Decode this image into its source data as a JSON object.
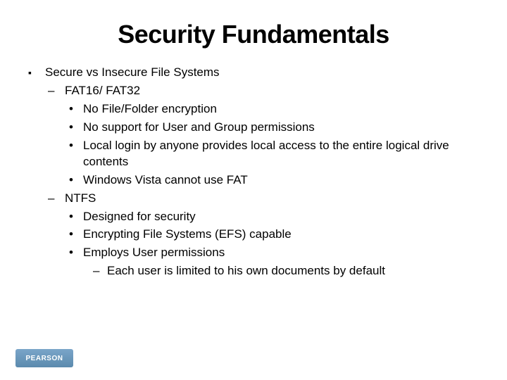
{
  "title": "Security Fundamentals",
  "topic": "Secure vs Insecure File Systems",
  "fat_label": "FAT16/ FAT32",
  "fat_points": [
    "No File/Folder encryption",
    "No support for User and Group permissions",
    "Local login by anyone provides local access to the entire logical drive contents",
    "Windows Vista cannot use FAT"
  ],
  "ntfs_label": "NTFS",
  "ntfs_points": [
    "Designed for security",
    "Encrypting File Systems (EFS) capable",
    "Employs User permissions"
  ],
  "ntfs_sub": "Each user is limited to his own documents by default",
  "logo": "PEARSON"
}
